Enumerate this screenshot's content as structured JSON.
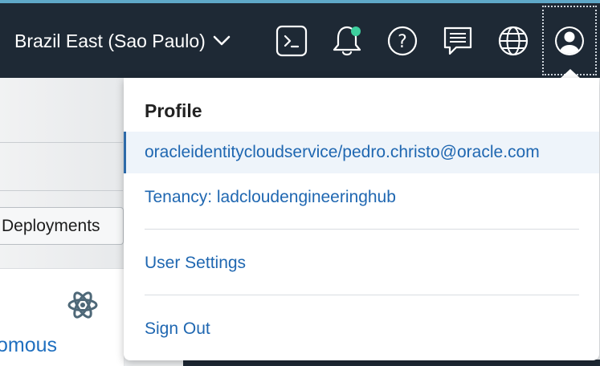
{
  "header": {
    "region_label": "Brazil East (Sao Paulo)",
    "icons": [
      "terminal-icon",
      "bell-icon",
      "help-icon",
      "chat-icon",
      "globe-icon",
      "user-icon"
    ],
    "notification_dot_color": "#3ecf9e",
    "background_color": "#1e2935"
  },
  "background_page": {
    "deployments_button": "Deployments",
    "card_link": "omous"
  },
  "profile_menu": {
    "title": "Profile",
    "user": "oracleidentitycloudservice/pedro.christo@oracle.com",
    "tenancy": "Tenancy: ladcloudengineeringhub",
    "user_settings": "User Settings",
    "sign_out": "Sign Out",
    "link_color": "#1f67b1"
  }
}
